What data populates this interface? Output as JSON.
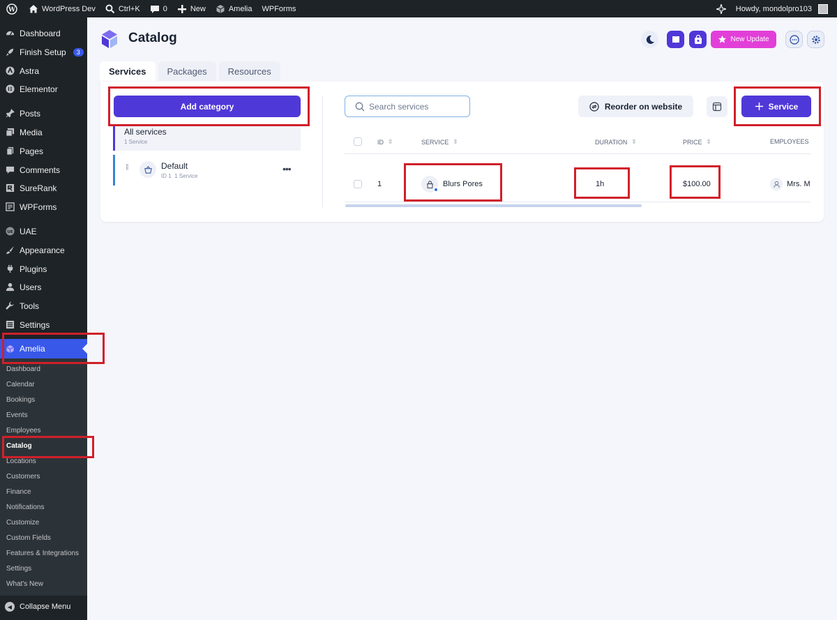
{
  "adminbar": {
    "site_name": "WordPress Dev",
    "search_shortcut": "Ctrl+K",
    "comments_count": "0",
    "new_label": "New",
    "amelia_label": "Amelia",
    "wpforms_label": "WPForms",
    "howdy": "Howdy, mondolpro103"
  },
  "sidebar": {
    "items": [
      {
        "label": "Dashboard",
        "icon": "dashboard-icon"
      },
      {
        "label": "Finish Setup",
        "icon": "rocket-icon",
        "badge": "3"
      },
      {
        "label": "Astra",
        "icon": "astra-icon"
      },
      {
        "label": "Elementor",
        "icon": "elementor-icon"
      },
      {
        "label": "Posts",
        "icon": "pin-icon"
      },
      {
        "label": "Media",
        "icon": "media-icon"
      },
      {
        "label": "Pages",
        "icon": "pages-icon"
      },
      {
        "label": "Comments",
        "icon": "comment-icon"
      },
      {
        "label": "SureRank",
        "icon": "surerank-icon"
      },
      {
        "label": "WPForms",
        "icon": "wpforms-icon"
      },
      {
        "label": "UAE",
        "icon": "uae-icon"
      },
      {
        "label": "Appearance",
        "icon": "brush-icon"
      },
      {
        "label": "Plugins",
        "icon": "plugin-icon"
      },
      {
        "label": "Users",
        "icon": "user-icon"
      },
      {
        "label": "Tools",
        "icon": "wrench-icon"
      },
      {
        "label": "Settings",
        "icon": "settings-icon"
      },
      {
        "label": "Amelia",
        "icon": "amelia-icon",
        "active": true
      }
    ],
    "submenu": [
      "Dashboard",
      "Calendar",
      "Bookings",
      "Events",
      "Employees",
      "Catalog",
      "Locations",
      "Customers",
      "Finance",
      "Notifications",
      "Customize",
      "Custom Fields",
      "Features & Integrations",
      "Settings",
      "What's New"
    ],
    "current_submenu": "Catalog",
    "collapse_label": "Collapse Menu"
  },
  "header": {
    "title": "Catalog",
    "new_update_label": "New Update"
  },
  "tabs": [
    {
      "label": "Services",
      "active": true
    },
    {
      "label": "Packages",
      "active": false
    },
    {
      "label": "Resources",
      "active": false
    }
  ],
  "categories": {
    "add_label": "Add category",
    "all": {
      "name": "All services",
      "count": "1 Service"
    },
    "items": [
      {
        "name": "Default",
        "id_text": "ID 1",
        "count": "1 Service"
      }
    ]
  },
  "services": {
    "search_placeholder": "Search services",
    "reorder_label": "Reorder on website",
    "add_label": "Service",
    "columns": [
      "ID",
      "SERVICE",
      "DURATION",
      "PRICE",
      "EMPLOYEES"
    ],
    "rows": [
      {
        "id": "1",
        "service": "Blurs Pores",
        "duration": "1h",
        "price": "$100.00",
        "employee": "Mrs. M"
      }
    ]
  },
  "colors": {
    "accent": "#4f38d8",
    "highlight": "#d0202a",
    "sidebar": "#1d2327",
    "active_menu": "#3858e9",
    "new_update": "#e23fd8"
  }
}
